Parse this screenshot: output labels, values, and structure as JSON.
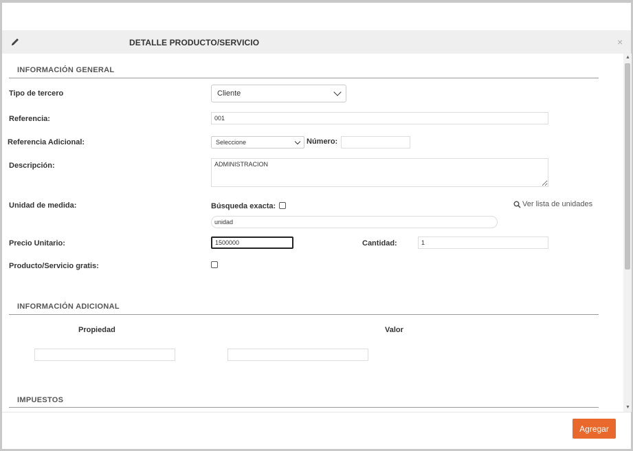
{
  "header": {
    "title": "DETALLE PRODUCTO/SERVICIO",
    "close_glyph": "×"
  },
  "general": {
    "section_title": "INFORMACIÓN GENERAL",
    "tipo_label": "Tipo de tercero",
    "tipo_value": "Cliente",
    "referencia_label": "Referencia:",
    "referencia_value": "001",
    "ref_adicional_label": "Referencia Adicional:",
    "ref_adicional_value": "Seleccione",
    "numero_label": "Número:",
    "numero_value": "",
    "descripcion_label": "Descripción:",
    "descripcion_value": "ADMINISTRACION",
    "unidad_label": "Unidad de medida:",
    "busqueda_label": "Búsqueda exacta:",
    "busqueda_checked": false,
    "unidad_value": "unidad",
    "ver_lista_label": "Ver lista de unidades",
    "precio_label": "Precio Unitario:",
    "precio_value": "1500000",
    "cantidad_label": "Cantidad:",
    "cantidad_value": "1",
    "gratis_label": "Producto/Servicio gratis:",
    "gratis_checked": false
  },
  "adicional": {
    "section_title": "INFORMACIÓN ADICIONAL",
    "propiedad_header": "Propiedad",
    "valor_header": "Valor",
    "propiedad_value": "",
    "valor_value": ""
  },
  "impuestos": {
    "section_title": "IMPUESTOS"
  },
  "footer": {
    "agregar_label": "Agregar"
  },
  "colors": {
    "accent": "#e8692b",
    "header_bg": "#efefef"
  }
}
